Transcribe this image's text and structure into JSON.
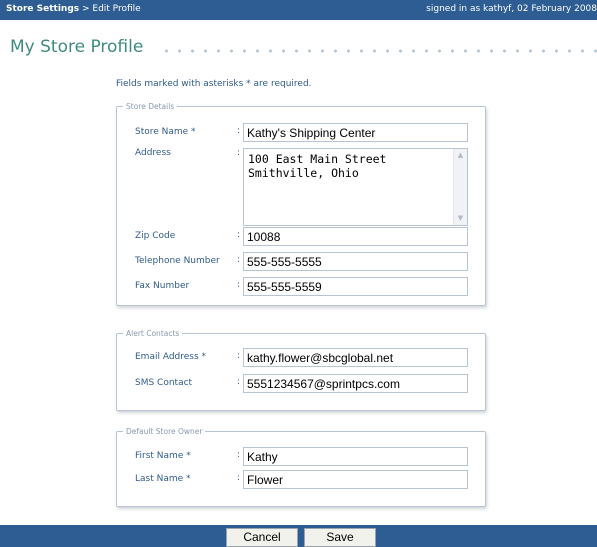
{
  "topbar": {
    "breadcrumb_section": "Store Settings",
    "breadcrumb_separator": " > ",
    "breadcrumb_page": "Edit Profile",
    "signed_in": "signed in as kathyf, 02 February 2008"
  },
  "page": {
    "title": "My Store Profile",
    "required_note": "Fields marked with asterisks * are required."
  },
  "store_details": {
    "legend": "Store Details",
    "store_name_label": "Store Name *",
    "store_name_value": "Kathy's Shipping Center",
    "address_label": "Address",
    "address_value": "100 East Main Street\nSmithville, Ohio",
    "zip_label": "Zip Code",
    "zip_value": "10088",
    "telephone_label": "Telephone Number",
    "telephone_value": "555-555-5555",
    "fax_label": "Fax Number",
    "fax_value": "555-555-5559"
  },
  "alert_contacts": {
    "legend": "Alert Contacts",
    "email_label": "Email Address *",
    "email_value": "kathy.flower@sbcglobal.net",
    "sms_label": "SMS Contact",
    "sms_value": "5551234567@sprintpcs.com"
  },
  "default_owner": {
    "legend": "Default Store Owner",
    "first_name_label": "First Name *",
    "first_name_value": "Kathy",
    "last_name_label": "Last Name *",
    "last_name_value": "Flower"
  },
  "actions": {
    "cancel_label": "Cancel",
    "save_label": "Save"
  },
  "colon": ":",
  "icons": {
    "scroll_up": "scroll-up-icon",
    "scroll_down": "scroll-down-icon"
  },
  "colors": {
    "bar": "#2d5d93",
    "title": "#3f8a80",
    "label": "#2f5b8c"
  }
}
